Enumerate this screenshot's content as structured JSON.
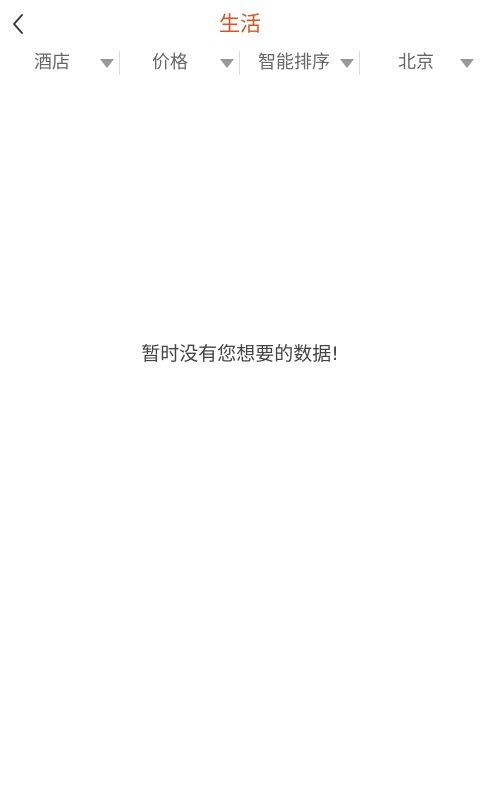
{
  "header": {
    "title": "生活",
    "back_icon": "chevron-left-icon",
    "title_color": "#d9531e"
  },
  "filters": [
    {
      "label": "酒店",
      "icon": "caret-down-icon"
    },
    {
      "label": "价格",
      "icon": "caret-down-icon"
    },
    {
      "label": "智能排序",
      "icon": "caret-down-icon"
    },
    {
      "label": "北京",
      "icon": "caret-down-icon"
    }
  ],
  "empty_state": {
    "message": "暂时没有您想要的数据!"
  }
}
